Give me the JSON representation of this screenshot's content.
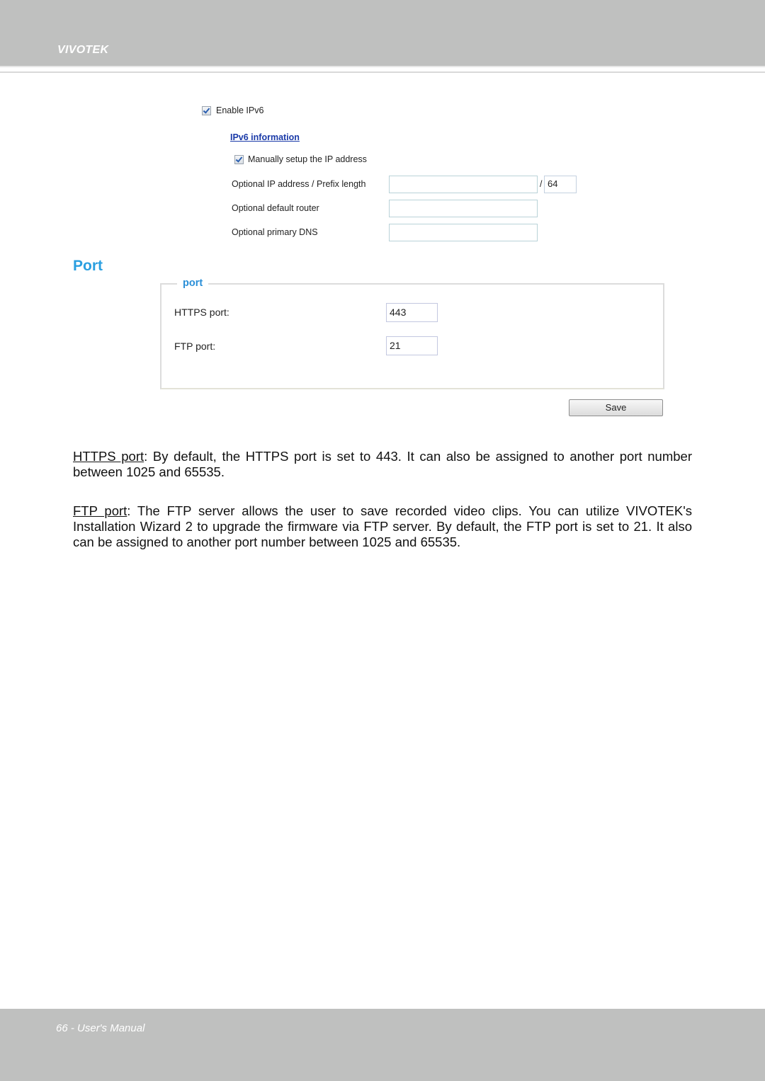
{
  "header": {
    "brand": "VIVOTEK"
  },
  "ipv6": {
    "enable_label": "Enable IPv6",
    "enable_checked": true,
    "info_link": "IPv6 information",
    "manual_label": "Manually setup the IP address",
    "manual_checked": true,
    "fields": [
      {
        "label": "Optional IP address / Prefix length",
        "value": "",
        "separator": "/",
        "prefix_value": "64"
      },
      {
        "label": "Optional default router",
        "value": ""
      },
      {
        "label": "Optional primary DNS",
        "value": ""
      }
    ]
  },
  "port_section": {
    "title": "Port",
    "legend": "port",
    "https_label": "HTTPS port:",
    "https_value": "443",
    "ftp_label": "FTP port:",
    "ftp_value": "21",
    "save_label": "Save"
  },
  "body": {
    "https_term": "HTTPS port",
    "https_text": ": By default, the HTTPS port is set to 443. It can also be assigned to another port number between 1025 and 65535.",
    "ftp_term": "FTP port",
    "ftp_text": ": The FTP server allows the user to save recorded video clips. You can utilize VIVOTEK's Installation Wizard 2 to upgrade the firmware via FTP server. By default, the FTP port is set to 21. It also can be assigned to another port number between 1025 and 65535."
  },
  "footer": {
    "page_label": "66 - User's Manual"
  }
}
